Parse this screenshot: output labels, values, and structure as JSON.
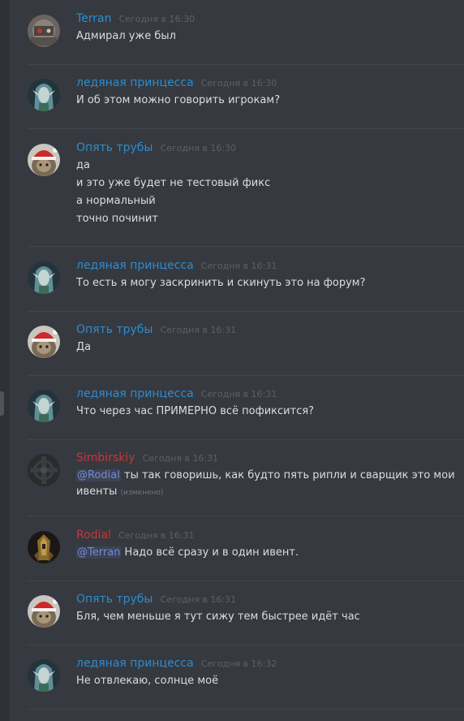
{
  "colors": {
    "background": "#36393f",
    "username_blue": "#2e8ccf",
    "username_red": "#c8363a",
    "timestamp": "#5d6066",
    "message_text": "#dcddde",
    "mention": "#7289da",
    "divider": "#42454a"
  },
  "messages": [
    {
      "username": "Terran",
      "timestamp": "Сегодня в 16:30",
      "avatar": "robot-avatar",
      "lines": [
        "Адмирал уже был"
      ]
    },
    {
      "username": "ледяная принцесса",
      "timestamp": "Сегодня в 16:30",
      "avatar": "elf-avatar",
      "lines": [
        "И об этом можно говорить игрокам?"
      ]
    },
    {
      "username": "Опять трубы",
      "timestamp": "Сегодня в 16:30",
      "avatar": "santa-cat-avatar",
      "lines": [
        "да",
        "и это уже будет не тестовый фикс",
        "а нормальный",
        "точно починит"
      ]
    },
    {
      "username": "ледяная принцесса",
      "timestamp": "Сегодня в 16:31",
      "avatar": "elf-avatar",
      "lines": [
        "То есть я могу заскринить и скинуть это на форум?"
      ]
    },
    {
      "username": "Опять трубы",
      "timestamp": "Сегодня в 16:31",
      "avatar": "santa-cat-avatar",
      "lines": [
        "Да"
      ]
    },
    {
      "username": "ледяная принцесса",
      "timestamp": "Сегодня в 16:31",
      "avatar": "elf-avatar",
      "lines": [
        "Что через час ПРИМЕРНО всё пофиксится?"
      ]
    },
    {
      "username": "Simbirskiy",
      "timestamp": "Сегодня в 16:31",
      "avatar": "celtic-cross-avatar",
      "mention": "@Rodial",
      "lines": [
        "ты так говоришь, как будто пять рипли и сварщик это мои",
        "ивенты"
      ],
      "edited_label": "(изменено)"
    },
    {
      "username": "Rodial",
      "timestamp": "Сегодня в 16:31",
      "avatar": "warrior-avatar",
      "mention": "@Terran",
      "lines": [
        "Надо всё сразу и в один ивент."
      ]
    },
    {
      "username": "Опять трубы",
      "timestamp": "Сегодня в 16:31",
      "avatar": "santa-cat-avatar",
      "lines": [
        "Бля, чем меньше я тут сижу тем быстрее идёт час"
      ]
    },
    {
      "username": "ледяная принцесса",
      "timestamp": "Сегодня в 16:32",
      "avatar": "elf-avatar",
      "lines": [
        "Не отвлекаю, солнце моё"
      ]
    }
  ]
}
